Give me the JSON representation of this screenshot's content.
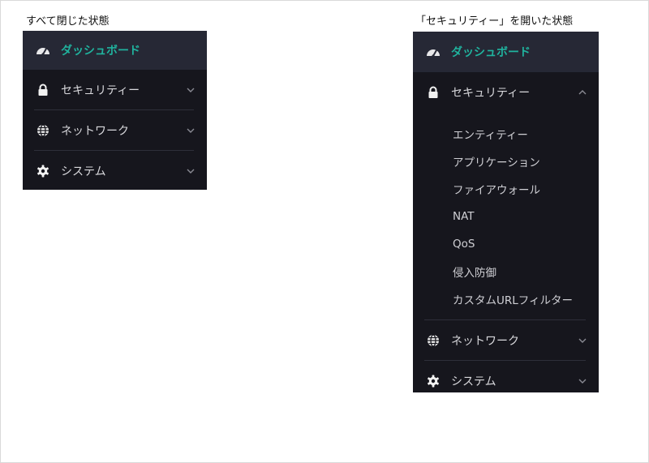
{
  "captions": {
    "left": "すべて閉じた状態",
    "right": "「セキュリティー」を開いた状態"
  },
  "colors": {
    "panel_bg": "#16161d",
    "active_bg": "#262835",
    "accent": "#20b39e"
  },
  "menu_closed": {
    "dashboard": {
      "label": "ダッシュボード",
      "icon": "gauge-icon"
    },
    "security": {
      "label": "セキュリティー",
      "icon": "lock-icon",
      "state": "collapsed"
    },
    "network": {
      "label": "ネットワーク",
      "icon": "globe-icon",
      "state": "collapsed"
    },
    "system": {
      "label": "システム",
      "icon": "gear-icon",
      "state": "collapsed"
    }
  },
  "menu_open": {
    "dashboard": {
      "label": "ダッシュボード",
      "icon": "gauge-icon"
    },
    "security": {
      "label": "セキュリティー",
      "icon": "lock-icon",
      "state": "expanded",
      "items": [
        "エンティティー",
        "アプリケーション",
        "ファイアウォール",
        "NAT",
        "QoS",
        "侵入防御",
        "カスタムURLフィルター"
      ]
    },
    "network": {
      "label": "ネットワーク",
      "icon": "globe-icon",
      "state": "collapsed"
    },
    "system": {
      "label": "システム",
      "icon": "gear-icon",
      "state": "collapsed"
    }
  }
}
